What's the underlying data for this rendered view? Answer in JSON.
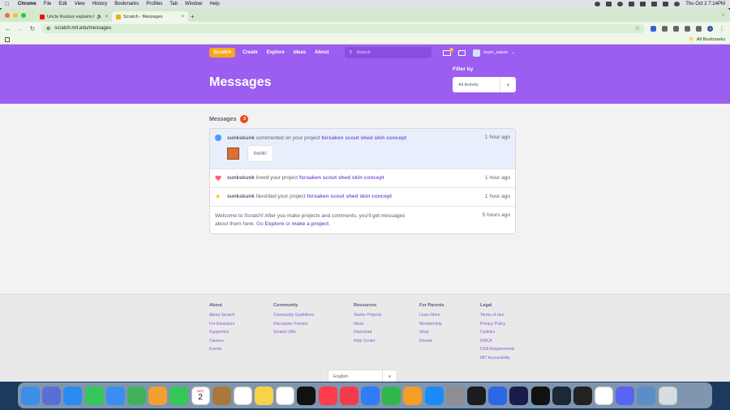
{
  "menubar": {
    "app": "Chrome",
    "items": [
      "File",
      "Edit",
      "View",
      "History",
      "Bookmarks",
      "Profiles",
      "Tab",
      "Window",
      "Help"
    ],
    "clock": "Thu Oct 2  7:14PM"
  },
  "browser": {
    "tabs": [
      {
        "title": "Uncle Ruckus explains h..."
      },
      {
        "title": "Scratch - Messages"
      }
    ],
    "url": "scratch.mit.edu/messages",
    "profile_initial": "A",
    "bookmarks_label": "All Bookmarks"
  },
  "scratch_nav": {
    "logo": "Scratch",
    "links": [
      "Create",
      "Explore",
      "Ideas",
      "About"
    ],
    "search_placeholder": "Search",
    "mail_badge": "3",
    "username": "team_saken"
  },
  "banner": {
    "title": "Messages",
    "filter_label": "Filter by",
    "filter_value": "All Activity"
  },
  "messages": {
    "header": "Messages",
    "count": "3",
    "items": [
      {
        "user": "sunkskunk",
        "action": "commented on your project",
        "project": "forsaken scout shed skin concept",
        "time": "1 hour ago",
        "comment": "bonk!"
      },
      {
        "user": "sunkskunk",
        "action": "loved your project",
        "project": "forsaken scout shed skin concept",
        "time": "1 hour ago"
      },
      {
        "user": "sunkskunk",
        "action": "favorited your project",
        "project": "forsaken scout shed skin concept",
        "time": "1 hour ago"
      }
    ],
    "welcome": {
      "text1": "Welcome to Scratch! After you make projects and comments, you'll get messages about them here. Go",
      "explore": "Explore",
      "or": "or",
      "make": "make a project",
      "dot": ".",
      "time": "5 hours ago"
    }
  },
  "footer": {
    "columns": [
      {
        "heading": "About",
        "links": [
          "About Scratch",
          "For Educators",
          "Supporters",
          "Careers",
          "Events"
        ]
      },
      {
        "heading": "Community",
        "links": [
          "Community Guidelines",
          "Discussion Forums",
          "Scratch Wiki"
        ]
      },
      {
        "heading": "Resources",
        "links": [
          "Starter Projects",
          "Ideas",
          "Download",
          "Help Center"
        ]
      },
      {
        "heading": "For Parents",
        "links": [
          "Learn More",
          "Membership",
          "Shop",
          "Donate"
        ]
      },
      {
        "heading": "Legal",
        "links": [
          "Terms of Use",
          "Privacy Policy",
          "Cookies",
          "DMCA",
          "DSA Requirements",
          "MIT Accessibility"
        ]
      }
    ],
    "language": "English"
  },
  "dock": {
    "calendar_month": "OCT",
    "calendar_day": "2",
    "icons": [
      "finder-icon",
      "launchpad-icon",
      "safari-icon",
      "messages-icon",
      "mail-icon",
      "maps-icon",
      "photos-icon",
      "facetime-icon",
      "calendar-icon",
      "notes-brown-icon",
      "reminders-icon",
      "notes-icon",
      "freeform-icon",
      "appletv-icon",
      "music-icon",
      "news-icon",
      "keynote-icon",
      "numbers-icon",
      "pages-icon",
      "appstore-icon",
      "settings-icon",
      "clock-icon",
      "app-blue-icon",
      "animate-icon",
      "capcut-icon",
      "steam-icon",
      "roblox-icon",
      "chrome-icon",
      "discord-icon",
      "preview-icon",
      "trash-icon"
    ],
    "colors": [
      "#3d8ee8",
      "#5a6fd6",
      "#2a8bf2",
      "#34c759",
      "#3a8ef0",
      "#43b05c",
      "#f0a030",
      "#34c759",
      "#ffffff",
      "#a8783c",
      "#ffffff",
      "#f8d34a",
      "#ffffff",
      "#111111",
      "#fa3c4c",
      "#f53a4c",
      "#2f7cf6",
      "#2fb84c",
      "#f59d27",
      "#1a8cf7",
      "#8e8e93",
      "#1c1c1e",
      "#2e66e6",
      "#1b1b4a",
      "#111111",
      "#1b2838",
      "#222222",
      "#ffffff",
      "#5865f2",
      "#5b8ec6",
      "#d8dde3"
    ]
  }
}
